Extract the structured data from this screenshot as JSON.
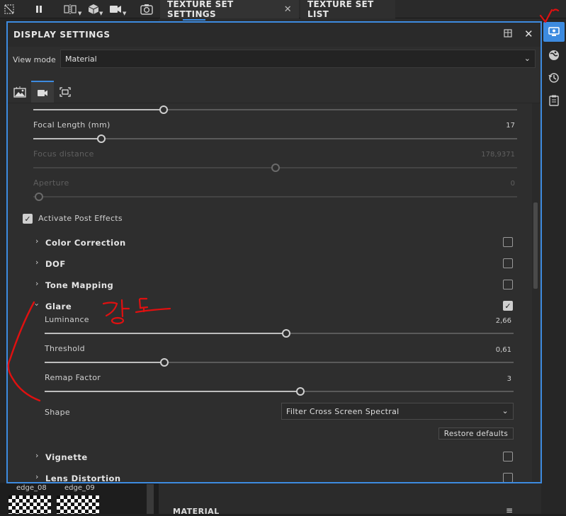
{
  "toolbar": {
    "icons": [
      "render-off-icon",
      "pause-icon",
      "symmetry-icon",
      "cube-icon",
      "camera-video-icon",
      "screenshot-icon"
    ]
  },
  "tabs": [
    {
      "label": "TEXTURE SET SETTINGS",
      "active": true,
      "close": "✕"
    },
    {
      "label": "TEXTURE SET LIST",
      "active": false
    }
  ],
  "right_strip": [
    "display-settings-icon",
    "environment-icon",
    "history-icon",
    "log-icon"
  ],
  "dialog": {
    "title": "DISPLAY SETTINGS",
    "view_mode_label": "View mode",
    "view_mode_value": "Material",
    "mode_tabs": [
      "environment-tab-icon",
      "camera-tab-icon",
      "viewport-tab-icon"
    ],
    "focal_length": {
      "label": "Focal Length (mm)",
      "value": "17",
      "fraction": 0.14
    },
    "focus_distance": {
      "label": "Focus distance",
      "value": "178,9371",
      "fraction": 0.5
    },
    "aperture": {
      "label": "Aperture",
      "value": "0",
      "fraction": 0.0
    },
    "top_slider_fraction": 0.27,
    "activate_post_effects": {
      "label": "Activate Post Effects",
      "checked": true
    },
    "sections": {
      "color_correction": {
        "label": "Color Correction",
        "checked": false
      },
      "dof": {
        "label": "DOF",
        "checked": false
      },
      "tone_mapping": {
        "label": "Tone Mapping",
        "checked": false
      },
      "glare": {
        "label": "Glare",
        "checked": true
      },
      "vignette": {
        "label": "Vignette",
        "checked": false
      },
      "lens_distortion": {
        "label": "Lens Distortion",
        "checked": false
      }
    },
    "glare": {
      "luminance": {
        "label": "Luminance",
        "value": "2,66",
        "fraction": 0.515
      },
      "threshold": {
        "label": "Threshold",
        "value": "0,61",
        "fraction": 0.255
      },
      "remap_factor": {
        "label": "Remap Factor",
        "value": "3",
        "fraction": 0.545
      },
      "shape_label": "Shape",
      "shape_value": "Filter Cross Screen Spectral",
      "restore_label": "Restore defaults"
    }
  },
  "thumbnails": [
    {
      "label": "edge_08"
    },
    {
      "label": "edge_09"
    }
  ],
  "bottom_panel": {
    "label": "MATERIAL",
    "menu_icon": "≡"
  },
  "annotation": {
    "text": "강도",
    "color": "#e01010"
  }
}
